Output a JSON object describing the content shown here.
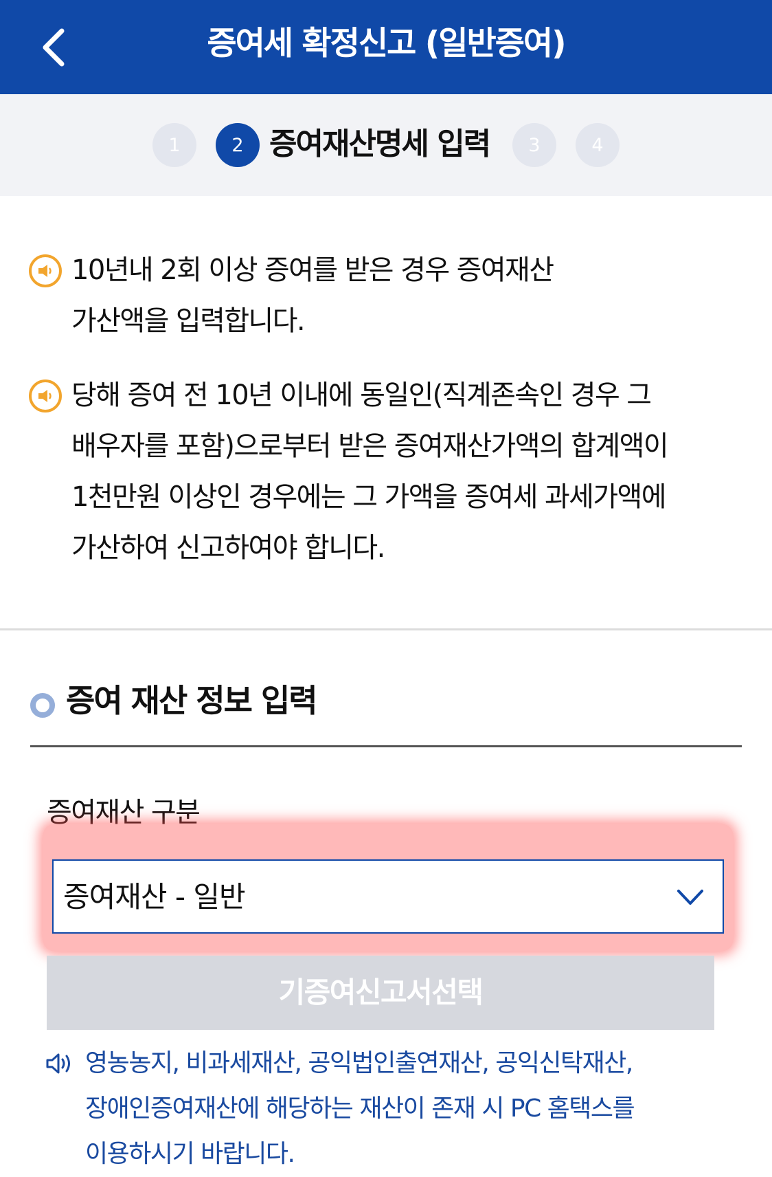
{
  "header": {
    "title": "증여세 확정신고 (일반증여)",
    "back_icon": "chevron-left-icon",
    "background_color": "#1049a8"
  },
  "steps": {
    "items": [
      "1",
      "2",
      "3",
      "4"
    ],
    "active_index": 1,
    "active_label": "증여재산명세 입력"
  },
  "notices": [
    {
      "icon": "speaker-icon",
      "lines": [
        "10년내 2회 이상 증여를 받은 경우 증여재산",
        "가산액을 입력합니다."
      ]
    },
    {
      "icon": "speaker-icon",
      "lines": [
        "당해 증여 전 10년 이내에 동일인(직계존속인 경우 그",
        "배우자를 포함)으로부터 받은 증여재산가액의 합계액이",
        "1천만원 이상인 경우에는 그 가액을 증여세 과세가액에",
        "가산하여 신고하여야 합니다."
      ]
    }
  ],
  "section": {
    "title": "증여 재산 정보 입력",
    "field_label": "증여재산 구분",
    "select_value": "증여재산 - 일반",
    "disabled_button_label": "기증여신고서선택"
  },
  "info_note": {
    "icon": "speaker-outline-icon",
    "lines": [
      "영농농지, 비과세재산, 공익법인출연재산, 공익신탁재산,",
      "장애인증여재산에 해당하는 재산이 존재 시 PC 홈택스를",
      "이용하시기 바랍니다."
    ],
    "color": "#1a4aa0"
  },
  "highlight_color": "#ff4646"
}
